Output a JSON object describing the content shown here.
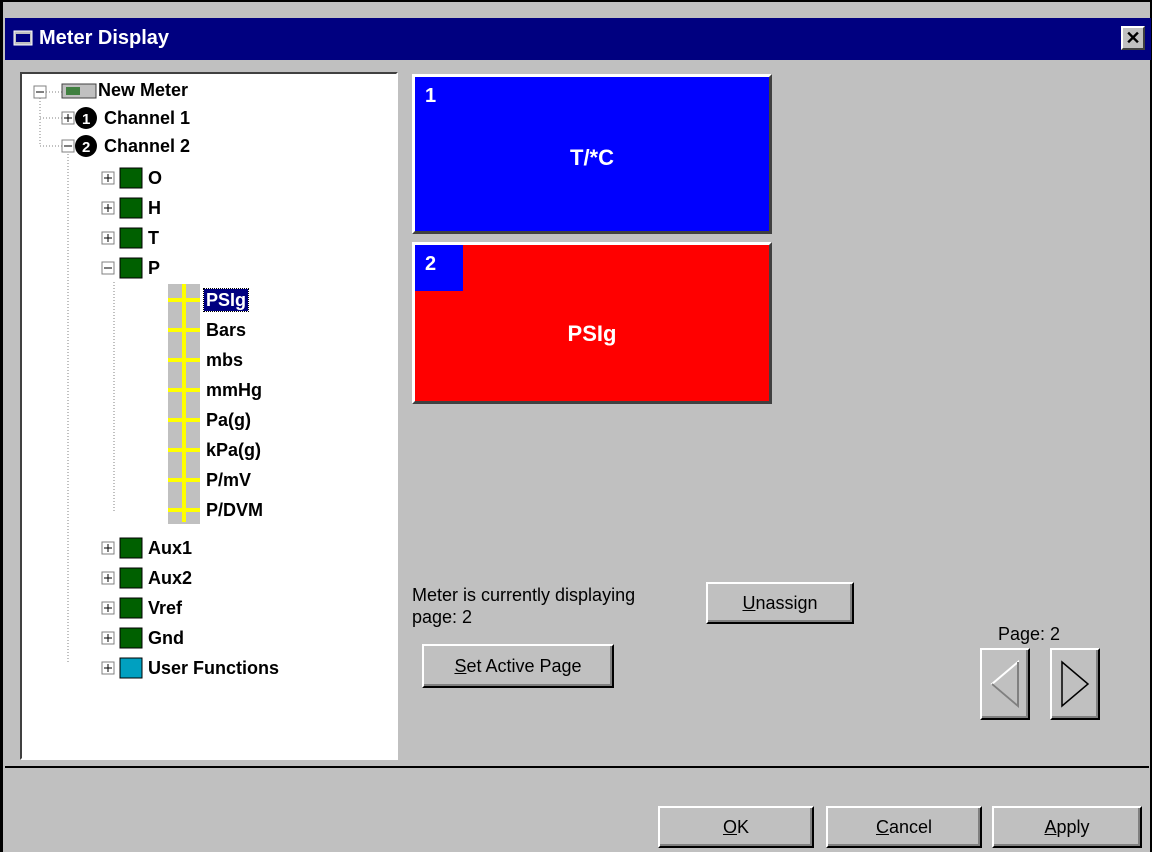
{
  "window": {
    "title": "Meter Display",
    "close_label": "✕"
  },
  "tree": {
    "root": "New Meter",
    "channel1": "Channel 1",
    "channel2": "Channel 2",
    "items": [
      "O",
      "H",
      "T",
      "P"
    ],
    "p_children": [
      "PSIg",
      "Bars",
      "mbs",
      "mmHg",
      "Pa(g)",
      "kPa(g)",
      "P/mV",
      "P/DVM"
    ],
    "more_items": [
      "Aux1",
      "Aux2",
      "Vref",
      "Gnd",
      "User Functions"
    ],
    "selected": "PSIg"
  },
  "pages": [
    {
      "number": "1",
      "label": "T/*C",
      "color": "#0000ff"
    },
    {
      "number": "2",
      "label": "PSIg",
      "color": "#ff0000",
      "number_bg": "#0000ff"
    }
  ],
  "status": {
    "line1": "Meter is currently displaying",
    "line2": "page: 2"
  },
  "buttons": {
    "unassign_u": "U",
    "unassign_rest": "nassign",
    "set_active_u": "S",
    "set_active_rest": "et Active Page",
    "ok_u": "O",
    "ok_rest": "K",
    "cancel_u": "C",
    "cancel_rest": "ancel",
    "apply_u": "A",
    "apply_rest": "pply"
  },
  "pager": {
    "label": "Page: 2"
  }
}
